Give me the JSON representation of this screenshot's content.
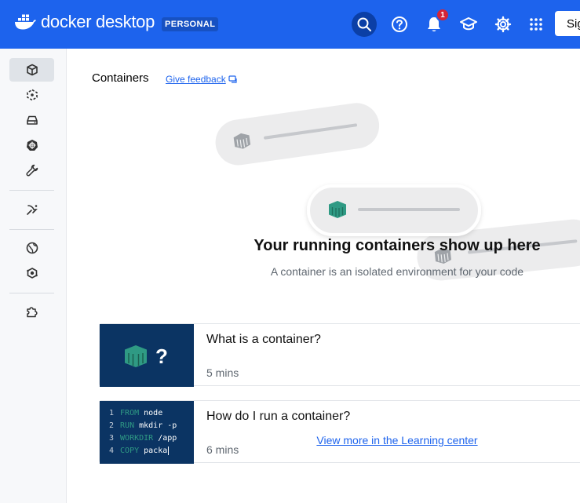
{
  "app": {
    "logo_text": "docker desktop",
    "plan": "PERSONAL",
    "signin_label": "Sig",
    "notification_count": "1"
  },
  "sidebar": {
    "items": [
      {
        "name": "containers",
        "icon": "container-icon",
        "active": true
      },
      {
        "name": "images",
        "icon": "images-icon"
      },
      {
        "name": "volumes",
        "icon": "volume-icon"
      },
      {
        "name": "kubernetes",
        "icon": "kubernetes-icon"
      },
      {
        "name": "builds",
        "icon": "wrench-icon"
      },
      {
        "name": "docker-scout",
        "icon": "scout-icon"
      },
      {
        "name": "docker-hub",
        "icon": "globe-icon"
      },
      {
        "name": "models",
        "icon": "model-icon"
      },
      {
        "name": "extensions",
        "icon": "puzzle-icon"
      }
    ]
  },
  "page": {
    "title": "Containers",
    "feedback": "Give feedback"
  },
  "empty_state": {
    "title": "Your running containers show up here",
    "subtitle": "A container is an isolated environment for your code"
  },
  "cards": [
    {
      "title": "What is a container?",
      "meta": "5 mins"
    },
    {
      "title": "How do I run a container?",
      "meta": "6 mins"
    }
  ],
  "code_sample": [
    {
      "n": "1",
      "kw": "FROM",
      "rest": " node"
    },
    {
      "n": "2",
      "kw": "RUN",
      "rest": " mkdir -p"
    },
    {
      "n": "3",
      "kw": "WORKDIR",
      "rest": " /app"
    },
    {
      "n": "4",
      "kw": "COPY",
      "rest": " packa"
    }
  ],
  "learn_more": "View more in the Learning center",
  "colors": {
    "brand": "#1d63ed",
    "accent_green": "#2f9a84",
    "badge_red": "#d52536"
  }
}
